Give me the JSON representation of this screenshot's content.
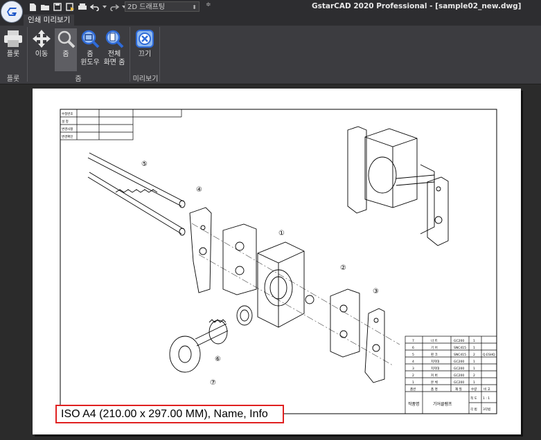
{
  "window": {
    "app_title": "GstarCAD 2020 Professional - [sample02_new.dwg]",
    "workspace_select": "2D 드래프팅"
  },
  "tabs": [
    {
      "label": "인쇄 미리보기",
      "active": true
    }
  ],
  "ribbon": {
    "buttons": {
      "plot": "플롯",
      "pan": "이동",
      "zoom": "줌",
      "zoom_window_1": "줌",
      "zoom_window_2": "윈도우",
      "zoom_extents_1": "전체",
      "zoom_extents_2": "화면 줌",
      "close": "끄기"
    },
    "groups": {
      "plot": "플롯",
      "zoom": "줌",
      "preview": "미리보기"
    }
  },
  "paper_info": "ISO A4 (210.00 x 297.00 MM), Name, Info",
  "drawing": {
    "revision_rows": [
      "수정번호",
      "설 정",
      "변경사항",
      "변경확인"
    ],
    "balloons": [
      "①",
      "②",
      "③",
      "④",
      "⑤",
      "⑥",
      "⑦"
    ],
    "parts_list": [
      {
        "no": "7",
        "name": "너 트",
        "material": "GC200",
        "qty": "1",
        "note": ""
      },
      {
        "no": "6",
        "name": "기 어",
        "material": "SNC415",
        "qty": "1",
        "note": ""
      },
      {
        "no": "5",
        "name": "핀 크",
        "material": "SNC415",
        "qty": "2",
        "note": "Q.ESHQ"
      },
      {
        "no": "4",
        "name": "지지대",
        "material": "GC200",
        "qty": "1",
        "note": ""
      },
      {
        "no": "3",
        "name": "지지대",
        "material": "GC200",
        "qty": "1",
        "note": ""
      },
      {
        "no": "2",
        "name": "커 버",
        "material": "GC200",
        "qty": "2",
        "note": ""
      },
      {
        "no": "1",
        "name": "본 체",
        "material": "GC200",
        "qty": "1",
        "note": ""
      }
    ],
    "parts_header": {
      "no": "품번",
      "name": "품 명",
      "material": "재 질",
      "qty": "수량",
      "note": "비 고"
    },
    "title_block": {
      "project_label": "작품명",
      "project_name": "기어클램프",
      "scale_label": "척 도",
      "scale_value": "1 : 1",
      "method_label": "각 법",
      "method_value": "3각법"
    }
  },
  "colors": {
    "accent_zoom": "#2f6bd8",
    "highlight": "#e02020"
  }
}
